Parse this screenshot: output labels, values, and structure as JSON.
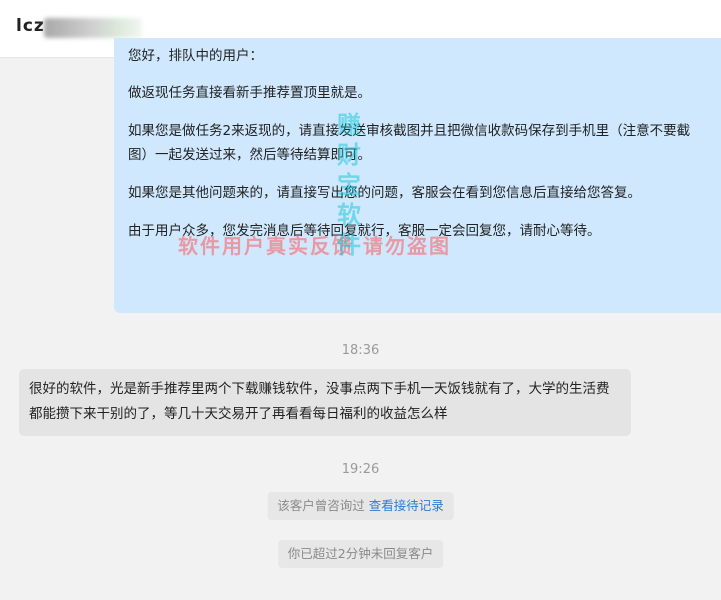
{
  "header": {
    "contact_name": "lcz"
  },
  "messages": {
    "outgoing_lines": [
      "您好，排队中的用户：",
      "做返现任务直接看新手推荐置顶里就是。",
      "如果您是做任务2来返现的，请直接发送审核截图并且把微信收款码保存到手机里（注意不要截图）一起发送过来，然后等待结算即可。",
      "如果您是其他问题来的，请直接写出您的问题，客服会在看到您信息后直接给您答复。",
      "由于用户众多，您发完消息后等待回复就行，客服一定会回复您，请耐心等待。"
    ],
    "time_1": "18:36",
    "incoming_text": "很好的软件，光是新手推荐里两个下载赚钱软件，没事点两下手机一天饭钱就有了，大学的生活费都能攒下来干别的了，等几十天交易开了再看看每日福利的收益怎么样",
    "time_2": "19:26",
    "system_1": "该客户曾咨询过",
    "system_1_link": "查看接待记录",
    "system_2": "你已超过2分钟未回复客户"
  },
  "watermarks": {
    "horizontal": "软件用户真实反馈 请勿盗图",
    "vertical": "赚财宝软件"
  },
  "colors": {
    "outgoing_bubble": "#cfe8fd",
    "incoming_bubble": "#e4e4e4",
    "link": "#2d7bd6",
    "watermark_red": "#ff5a5a",
    "watermark_cyan": "#00c2d4"
  }
}
